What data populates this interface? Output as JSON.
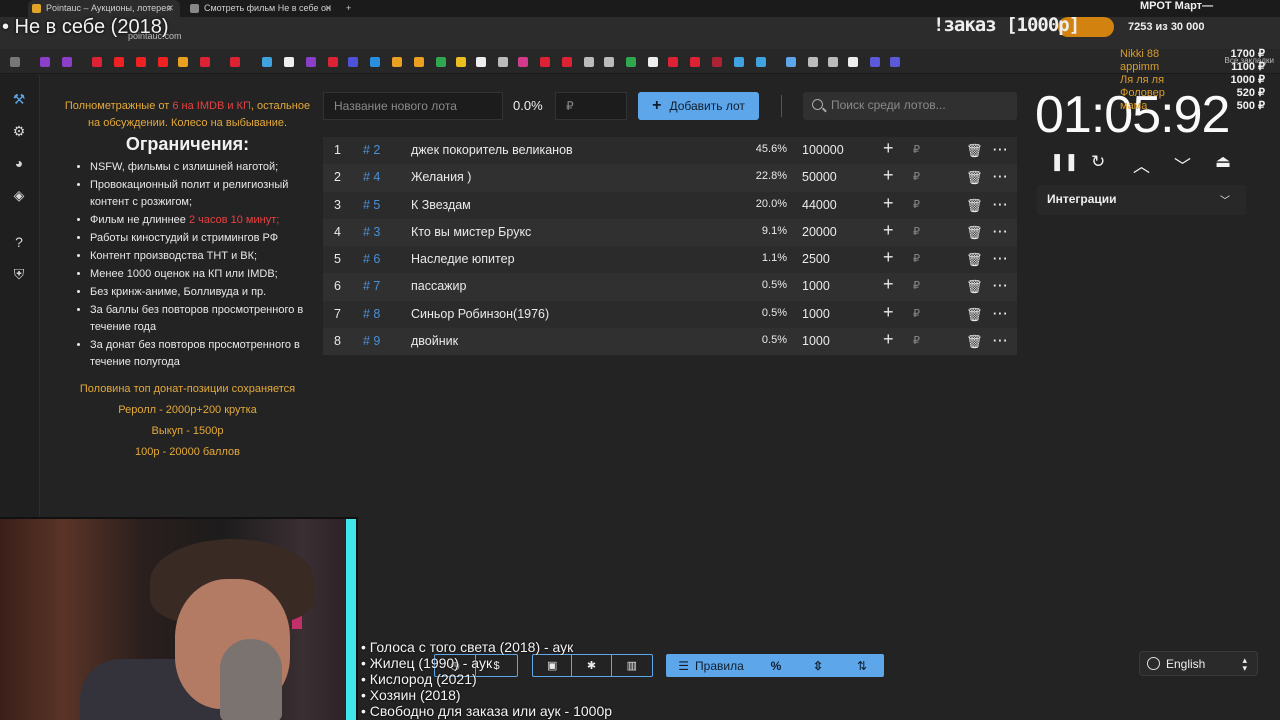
{
  "browser": {
    "tabs": [
      {
        "label": "Pointauc – Аукционы, лотерея"
      },
      {
        "label": "Смотреть фильм Не в себе он"
      }
    ],
    "address": "pointauc.com",
    "bookmarks_all": "Все закладки"
  },
  "overlay": {
    "stream_title": "• Не в себе (2018)",
    "order_label": "!заказ [1000р]",
    "mrot": "МРОТ Март—",
    "goal": "7253  из 30 000",
    "donors": [
      "Nikki 88",
      "appimm",
      "Ля ля ля",
      "Фоловер",
      "мама"
    ],
    "amounts": [
      "1700 ₽",
      "1100 ₽",
      "1000 ₽",
      "520 ₽",
      "500 ₽"
    ],
    "bottom_list": [
      "• Голоса с того света (2018) - аук",
      "• Жилец (1990) - аук",
      "• Кислород (2021)",
      "• Хозяин (2018)",
      "• Свободно для заказа или аук - 1000р"
    ]
  },
  "rules": {
    "intro_1": "Полнометражные от ",
    "intro_red": "6 на IMDB и КП",
    "intro_2": ", остальное на обсуждении. Колесо на выбывание.",
    "heading": "Ограничения:",
    "items": [
      {
        "text": "NSFW, фильмы с излишней наготой;"
      },
      {
        "text": "Провокационный полит и религиозный контент с розжигом;"
      },
      {
        "text": "Фильм не длиннее ",
        "red": "2 часов 10 минут;"
      },
      {
        "text": "Работы киностудий и стримингов РФ"
      },
      {
        "text": "Контент производства ТНТ и ВК;"
      },
      {
        "text": "Менее 1000 оценок на КП или IMDB;"
      },
      {
        "text": "Без кринж-аниме, Болливуда и пр."
      },
      {
        "text": "За баллы без повторов просмотренного в течение года"
      },
      {
        "text": "За донат без повторов просмотренного в течение полугода"
      }
    ],
    "footer": [
      "Половина топ донат-позиции сохраняется",
      "Реролл - 2000р+200 крутка",
      "Выкуп - 1500р",
      "100р - 20000 баллов"
    ]
  },
  "controls": {
    "lot_name_placeholder": "Название нового лота",
    "percent": "0.0%",
    "amount_placeholder": "₽",
    "add_button": "Добавить лот",
    "search_placeholder": "Поиск среди лотов..."
  },
  "lots": [
    {
      "idx": "1",
      "id": "# 2",
      "name": "джек покоритель великанов",
      "pct": "45.6%",
      "amount": "100000"
    },
    {
      "idx": "2",
      "id": "# 4",
      "name": "Желания )",
      "pct": "22.8%",
      "amount": "50000"
    },
    {
      "idx": "3",
      "id": "# 5",
      "name": "К Звездам",
      "pct": "20.0%",
      "amount": "44000"
    },
    {
      "idx": "4",
      "id": "# 3",
      "name": "Кто вы мистер Брукс",
      "pct": "9.1%",
      "amount": "20000"
    },
    {
      "idx": "5",
      "id": "# 6",
      "name": "Наследие юпитер",
      "pct": "1.1%",
      "amount": "2500"
    },
    {
      "idx": "6",
      "id": "# 7",
      "name": "пассажир",
      "pct": "0.5%",
      "amount": "1000"
    },
    {
      "idx": "7",
      "id": "# 8",
      "name": "Синьор Робинзон(1976)",
      "pct": "0.5%",
      "amount": "1000"
    },
    {
      "idx": "8",
      "id": "# 9",
      "name": "двойник",
      "pct": "0.5%",
      "amount": "1000"
    }
  ],
  "row_symbols": {
    "plus": "+",
    "rub": "₽",
    "trash": "🗑",
    "more": "···"
  },
  "timer": {
    "value": "01:05:92"
  },
  "integrations": {
    "label": "Интеграции"
  },
  "toolbar": {
    "rules_label": "Правила"
  },
  "language": {
    "selected": "English"
  }
}
